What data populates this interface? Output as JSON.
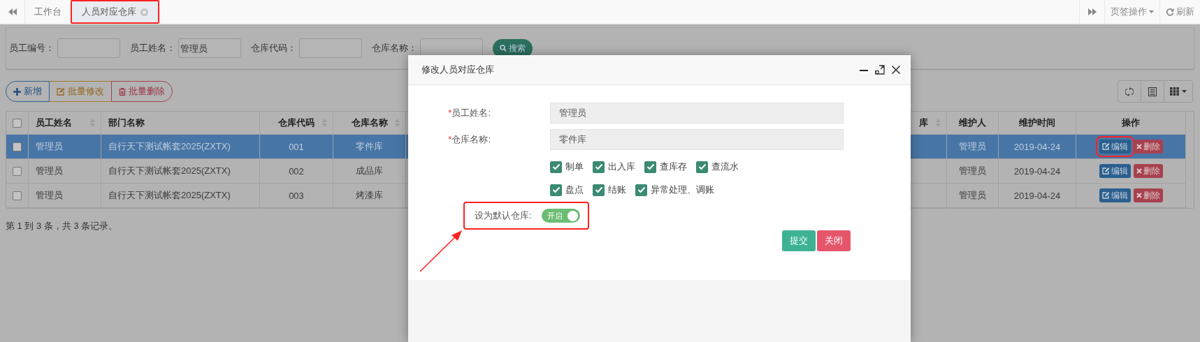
{
  "tab_bar": {
    "tabs": [
      {
        "label": "工作台",
        "selected": false,
        "closable": false,
        "highlighted": false
      },
      {
        "label": "人员对应仓库",
        "selected": true,
        "closable": true,
        "highlighted": true
      }
    ],
    "tab_menu": "页签操作",
    "refresh": "刷新"
  },
  "search": {
    "fields": [
      {
        "label": "员工编号："
      },
      {
        "label": "员工姓名：",
        "value": "管理员"
      },
      {
        "label": "仓库代码："
      },
      {
        "label": "仓库名称："
      }
    ],
    "button": "搜索"
  },
  "toolbar": {
    "buttons": [
      {
        "label": "新增",
        "kind": "add"
      },
      {
        "label": "批量修改",
        "kind": "edit"
      },
      {
        "label": "批量删除",
        "kind": "delete"
      }
    ]
  },
  "table": {
    "columns": [
      {
        "label": "员工姓名",
        "sortable": true
      },
      {
        "label": "部门名称",
        "sortable": false
      },
      {
        "label": "仓库代码",
        "sortable": true
      },
      {
        "label": "仓库名称",
        "sortable": true
      },
      {
        "label": "库",
        "sortable": true
      },
      {
        "label": "维护人",
        "sortable": false
      },
      {
        "label": "维护时间",
        "sortable": false
      },
      {
        "label": "操作",
        "sortable": false
      }
    ],
    "header_checked": false,
    "rows": [
      {
        "selected": true,
        "checked": false,
        "cells": [
          "管理员",
          "自行天下测试帐套2025(ZXTX)",
          "001",
          "零件库",
          "",
          "管理员",
          "2019-04-24"
        ],
        "actions": [
          {
            "label": "编辑",
            "kind": "edit",
            "highlighted": true
          },
          {
            "label": "删除",
            "kind": "delete",
            "highlighted": false
          }
        ]
      },
      {
        "selected": false,
        "checked": false,
        "cells": [
          "管理员",
          "自行天下测试帐套2025(ZXTX)",
          "002",
          "成品库",
          "",
          "管理员",
          "2019-04-24"
        ],
        "actions": [
          {
            "label": "编辑",
            "kind": "edit",
            "highlighted": false
          },
          {
            "label": "删除",
            "kind": "delete",
            "highlighted": false
          }
        ]
      },
      {
        "selected": false,
        "checked": false,
        "cells": [
          "管理员",
          "自行天下测试帐套2025(ZXTX)",
          "003",
          "烤漆库",
          "",
          "管理员",
          "2019-04-24"
        ],
        "actions": [
          {
            "label": "编辑",
            "kind": "edit",
            "highlighted": false
          },
          {
            "label": "删除",
            "kind": "delete",
            "highlighted": false
          }
        ]
      }
    ],
    "footer": "第 1 到 3 条，共 3 条记录。"
  },
  "dialog": {
    "title": "修改人员对应仓库",
    "fields": [
      {
        "required_mark": "*",
        "label": "员工姓名:",
        "value": "管理员"
      },
      {
        "required_mark": "*",
        "label": "仓库名称:",
        "value": "零件库"
      }
    ],
    "permissions": [
      [
        {
          "label": "制单",
          "checked": true
        },
        {
          "label": "出入库",
          "checked": true
        },
        {
          "label": "查库存",
          "checked": true
        },
        {
          "label": "查流水",
          "checked": true
        }
      ],
      [
        {
          "label": "盘点",
          "checked": true
        },
        {
          "label": "结账",
          "checked": true
        },
        {
          "label": "异常处理、调账",
          "checked": true
        }
      ]
    ],
    "default_toggle": {
      "label": "设为默认仓库:",
      "on": true,
      "text": "开启",
      "highlighted": true
    },
    "buttons": [
      {
        "label": "提交",
        "kind": "submit"
      },
      {
        "label": "关闭",
        "kind": "close"
      }
    ]
  }
}
